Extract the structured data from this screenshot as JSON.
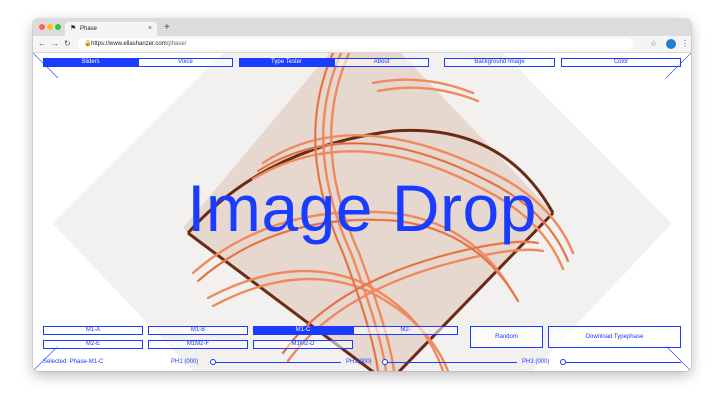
{
  "browser": {
    "tab_title": "Phase",
    "url_host": "https://www.ellashanzer.com",
    "url_path": "/phase/"
  },
  "nav": {
    "sliders": "Sliders",
    "voice": "Voice",
    "type_tester": "Type Tester",
    "about": "About",
    "background_image": "Background Image",
    "color": "Color"
  },
  "main": {
    "headline": "Image Drop"
  },
  "styles": {
    "row1": [
      "M1-A",
      "M1-B",
      "M1-C",
      "M2-"
    ],
    "row2": [
      "M2-E",
      "M1M2-F",
      "M1M2-D"
    ],
    "selected_label": "Selected: Phase-M1-C"
  },
  "actions": {
    "random": "Random",
    "download": "Download Typephase"
  },
  "sliders": {
    "ph1_label": "PH1 (000)",
    "ph2_label": "PH2(000)",
    "ph3_label": "PH3 (000)",
    "ph1_value": 0,
    "ph2_value": 0,
    "ph3_value": 0
  },
  "colors": {
    "accent": "#1a3cff",
    "wire": "#ef8a5e"
  }
}
